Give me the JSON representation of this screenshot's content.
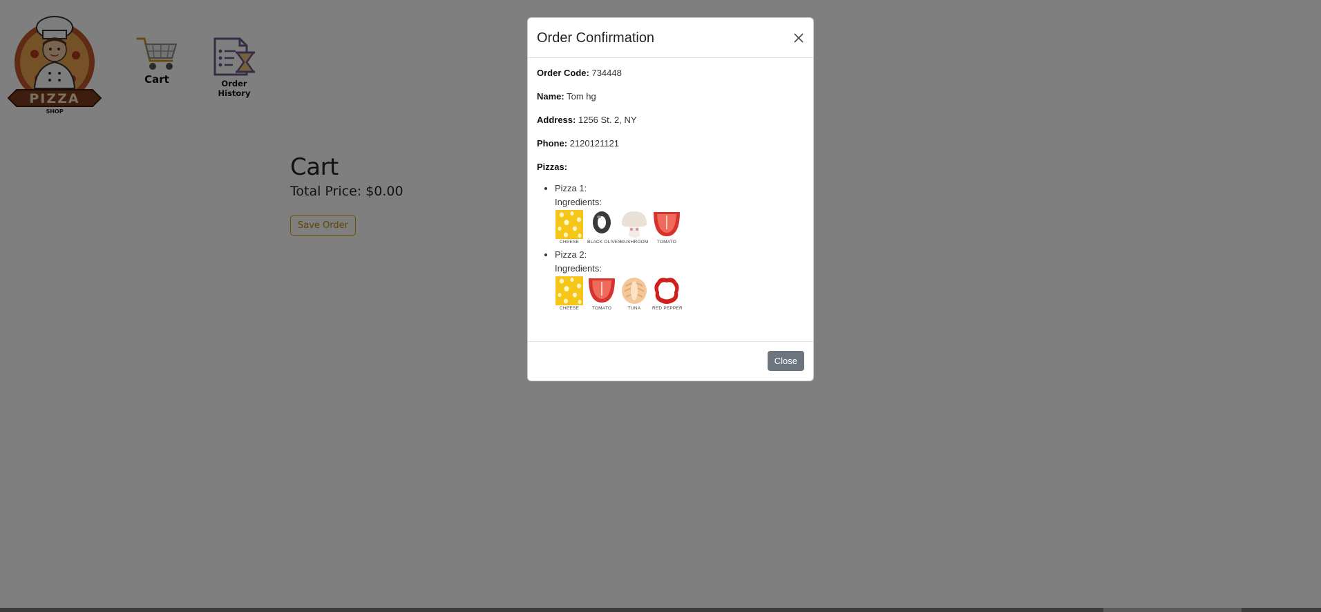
{
  "nav": {
    "logo_text": "PIZZA",
    "logo_subtext": "SHOP",
    "cart_label": "Cart",
    "history_label": "Order History"
  },
  "cart": {
    "title": "Cart",
    "total_price": "Total Price: $0.00",
    "save_button": "Save Order"
  },
  "modal": {
    "title": "Order Confirmation",
    "order_code_label": "Order Code:",
    "order_code": "734448",
    "name_label": "Name:",
    "name": "Tom hg",
    "address_label": "Address:",
    "address": "1256 St. 2, NY",
    "phone_label": "Phone:",
    "phone": "2120121121",
    "pizzas_label": "Pizzas:",
    "ingredients_label": "Ingredients:",
    "pizzas": [
      {
        "label": "Pizza 1:",
        "ingredients": [
          "CHEESE",
          "BLACK OLIVES",
          "MUSHROOM",
          "TOMATO"
        ]
      },
      {
        "label": "Pizza 2:",
        "ingredients": [
          "CHEESE",
          "TOMATO",
          "TUNA",
          "RED PEPPER"
        ]
      }
    ],
    "close_button": "Close"
  },
  "colors": {
    "accent_outline": "#d9a400",
    "close_button_bg": "#6c757d",
    "overlay": "rgba(0,0,0,0.5)"
  },
  "icons": {
    "logo": "chef-pizza-logo-icon",
    "cart": "shopping-cart-icon",
    "history": "order-history-icon",
    "close": "close-icon"
  }
}
